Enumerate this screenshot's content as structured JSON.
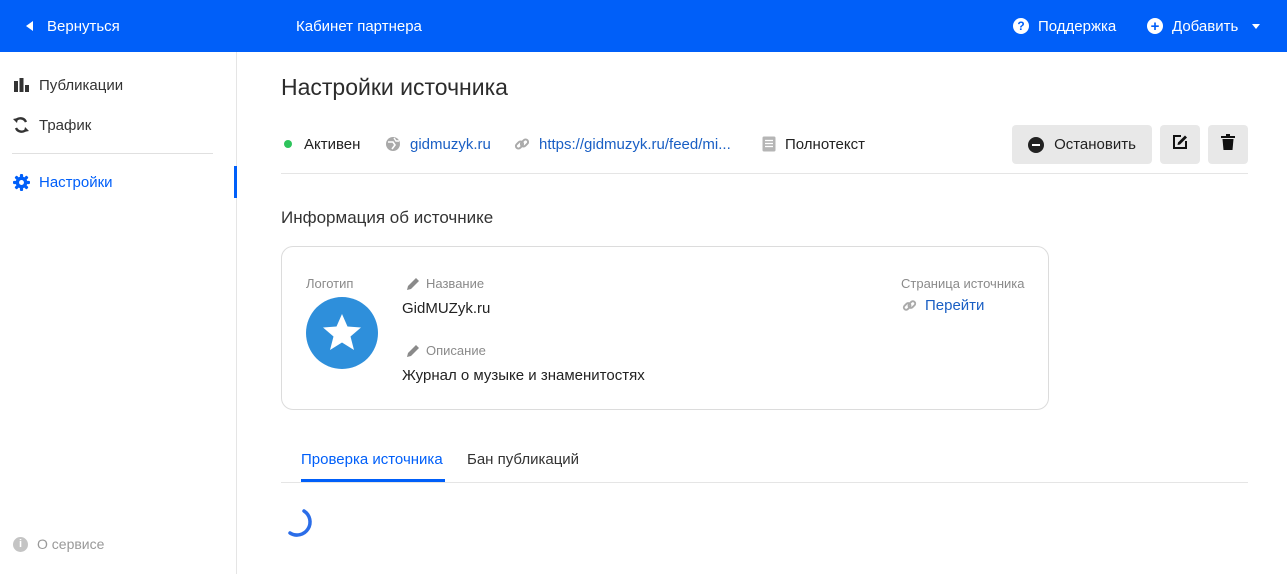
{
  "topbar": {
    "back_label": "Вернуться",
    "title": "Кабинет партнера",
    "support_label": "Поддержка",
    "add_label": "Добавить",
    "bg_color": "#005ff9"
  },
  "sidebar": {
    "items": [
      {
        "label": "Публикации",
        "icon": "bar-chart-icon",
        "active": false
      },
      {
        "label": "Трафик",
        "icon": "refresh-icon",
        "active": false
      },
      {
        "label": "Настройки",
        "icon": "gear-icon",
        "active": true
      }
    ],
    "about_label": "О сервисе"
  },
  "main": {
    "page_title": "Настройки источника",
    "status": {
      "state": "Активен",
      "state_color": "#2ec45c",
      "domain": "gidmuzyk.ru",
      "feed_url": "https://gidmuzyk.ru/feed/mi...",
      "content_type": "Полнотекст",
      "stop_label": "Остановить"
    },
    "info_title": "Информация об источнике",
    "card": {
      "logo_label": "Логотип",
      "name_label": "Название",
      "name_value": "GidMUZyk.ru",
      "description_label": "Описание",
      "description_value": "Журнал о музыке и знаменитостях",
      "source_page_label": "Страница источника",
      "source_page_link": "Перейти"
    },
    "tabs": [
      {
        "label": "Проверка источника",
        "active": true
      },
      {
        "label": "Бан публикаций",
        "active": false
      }
    ]
  }
}
